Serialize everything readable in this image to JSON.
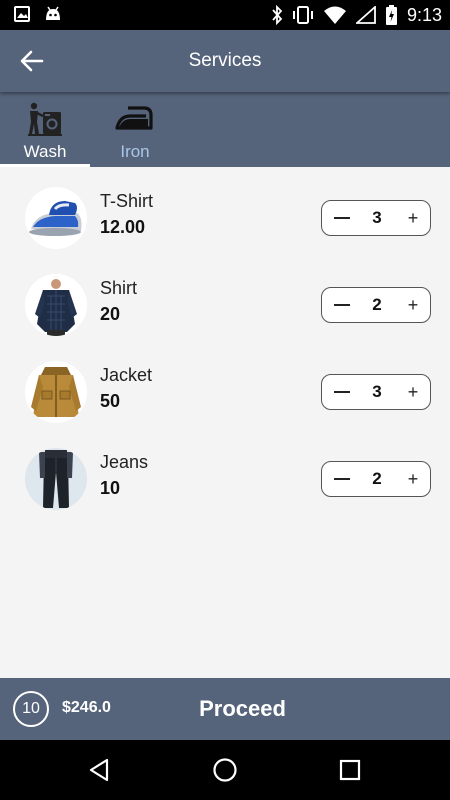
{
  "status_bar": {
    "time": "9:13",
    "icons": [
      "image-icon",
      "android-icon",
      "bluetooth-icon",
      "vibrate-icon",
      "wifi-icon",
      "signal-icon",
      "battery-charging-icon"
    ]
  },
  "app_bar": {
    "title": "Services",
    "back_icon": "arrow-left-icon"
  },
  "tabs": [
    {
      "label": "Wash",
      "icon": "washing-icon",
      "active": true
    },
    {
      "label": "Iron",
      "icon": "iron-icon",
      "active": false
    }
  ],
  "items": [
    {
      "name": "T-Shirt",
      "price": "12.00",
      "quantity": "3",
      "image": "clothes-iron-photo"
    },
    {
      "name": "Shirt",
      "price": "20",
      "quantity": "2",
      "image": "shirt-photo"
    },
    {
      "name": "Jacket",
      "price": "50",
      "quantity": "3",
      "image": "jacket-photo"
    },
    {
      "name": "Jeans",
      "price": "10",
      "quantity": "2",
      "image": "jeans-photo"
    }
  ],
  "stepper": {
    "minus": "—",
    "plus": "+"
  },
  "footer": {
    "count": "10",
    "total": "$246.0",
    "proceed_label": "Proceed"
  },
  "colors": {
    "primary": "#56647b",
    "inactive_tab": "#a9c6e8",
    "background": "#f4f4f4"
  }
}
